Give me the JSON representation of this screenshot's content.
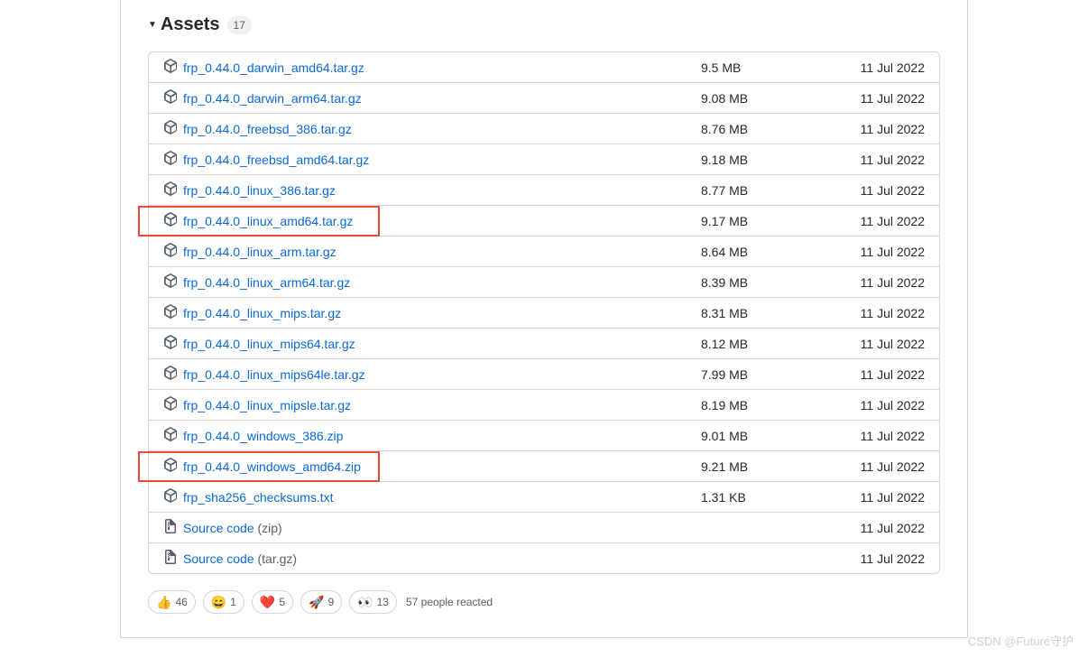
{
  "header": {
    "title": "Assets",
    "count": "17"
  },
  "assets": [
    {
      "name": "frp_0.44.0_darwin_amd64.tar.gz",
      "size": "9.5 MB",
      "date": "11 Jul 2022",
      "type": "pkg",
      "hl": false
    },
    {
      "name": "frp_0.44.0_darwin_arm64.tar.gz",
      "size": "9.08 MB",
      "date": "11 Jul 2022",
      "type": "pkg",
      "hl": false
    },
    {
      "name": "frp_0.44.0_freebsd_386.tar.gz",
      "size": "8.76 MB",
      "date": "11 Jul 2022",
      "type": "pkg",
      "hl": false
    },
    {
      "name": "frp_0.44.0_freebsd_amd64.tar.gz",
      "size": "9.18 MB",
      "date": "11 Jul 2022",
      "type": "pkg",
      "hl": false
    },
    {
      "name": "frp_0.44.0_linux_386.tar.gz",
      "size": "8.77 MB",
      "date": "11 Jul 2022",
      "type": "pkg",
      "hl": false
    },
    {
      "name": "frp_0.44.0_linux_amd64.tar.gz",
      "size": "9.17 MB",
      "date": "11 Jul 2022",
      "type": "pkg",
      "hl": true
    },
    {
      "name": "frp_0.44.0_linux_arm.tar.gz",
      "size": "8.64 MB",
      "date": "11 Jul 2022",
      "type": "pkg",
      "hl": false
    },
    {
      "name": "frp_0.44.0_linux_arm64.tar.gz",
      "size": "8.39 MB",
      "date": "11 Jul 2022",
      "type": "pkg",
      "hl": false
    },
    {
      "name": "frp_0.44.0_linux_mips.tar.gz",
      "size": "8.31 MB",
      "date": "11 Jul 2022",
      "type": "pkg",
      "hl": false
    },
    {
      "name": "frp_0.44.0_linux_mips64.tar.gz",
      "size": "8.12 MB",
      "date": "11 Jul 2022",
      "type": "pkg",
      "hl": false
    },
    {
      "name": "frp_0.44.0_linux_mips64le.tar.gz",
      "size": "7.99 MB",
      "date": "11 Jul 2022",
      "type": "pkg",
      "hl": false
    },
    {
      "name": "frp_0.44.0_linux_mipsle.tar.gz",
      "size": "8.19 MB",
      "date": "11 Jul 2022",
      "type": "pkg",
      "hl": false
    },
    {
      "name": "frp_0.44.0_windows_386.zip",
      "size": "9.01 MB",
      "date": "11 Jul 2022",
      "type": "pkg",
      "hl": false
    },
    {
      "name": "frp_0.44.0_windows_amd64.zip",
      "size": "9.21 MB",
      "date": "11 Jul 2022",
      "type": "pkg",
      "hl": true
    },
    {
      "name": "frp_sha256_checksums.txt",
      "size": "1.31 KB",
      "date": "11 Jul 2022",
      "type": "pkg",
      "hl": false
    },
    {
      "name": "Source code",
      "suffix": " (zip)",
      "size": "",
      "date": "11 Jul 2022",
      "type": "zip",
      "hl": false
    },
    {
      "name": "Source code",
      "suffix": " (tar.gz)",
      "size": "",
      "date": "11 Jul 2022",
      "type": "zip",
      "hl": false
    }
  ],
  "reactions": [
    {
      "emoji": "👍",
      "count": "46"
    },
    {
      "emoji": "😄",
      "count": "1"
    },
    {
      "emoji": "❤️",
      "count": "5"
    },
    {
      "emoji": "🚀",
      "count": "9"
    },
    {
      "emoji": "👀",
      "count": "13"
    }
  ],
  "reactions_summary": "57 people reacted",
  "watermark": "CSDN @Future守护"
}
